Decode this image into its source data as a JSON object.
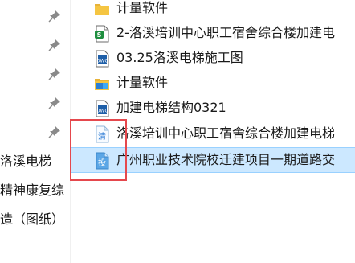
{
  "quick_access": {
    "items": [
      {
        "label": "洛溪电梯"
      },
      {
        "label": "精神康复综"
      },
      {
        "label": "造（图纸）"
      }
    ]
  },
  "files": [
    {
      "name": "计量软件",
      "icon": "folder-icon"
    },
    {
      "name": "2-洛溪培训中心职工宿舍综合楼加建电",
      "icon": "spreadsheet-file-icon"
    },
    {
      "name": "03.25洛溪电梯施工图",
      "icon": "cad-file-icon"
    },
    {
      "name": "计量软件",
      "icon": "folder-app-icon"
    },
    {
      "name": "加建电梯结构0321",
      "icon": "cad-file-icon"
    },
    {
      "name": "洛溪培训中心职工宿舍综合楼加建电梯",
      "icon": "qing-file-icon",
      "badge": "清"
    },
    {
      "name": "广州职业技术院校迁建项目一期道路交",
      "icon": "tou-file-icon",
      "badge": "投",
      "selected": true
    }
  ],
  "colors": {
    "selection": "#cce8ff",
    "selection_border": "#99d1ff",
    "highlight": "#e5484d",
    "folder": "#f5c542",
    "spreadsheet": "#1e8e3e",
    "cad": "#1f5fa8"
  }
}
